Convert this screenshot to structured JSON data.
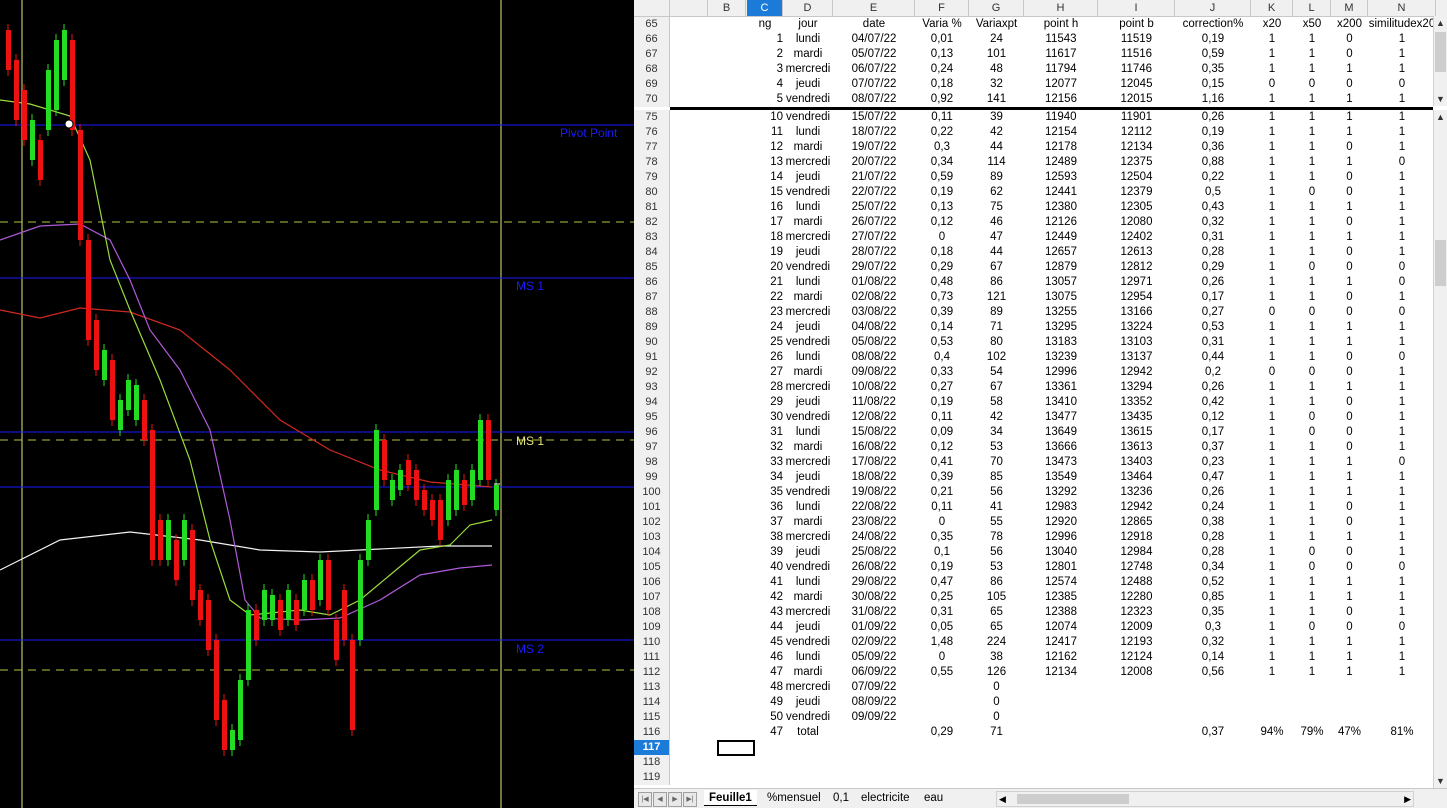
{
  "chart": {
    "labels": {
      "pivot": "Pivot Point",
      "ms1_upper": "MS 1",
      "ms1_lower": "MS 1",
      "ms2": "MS 2"
    },
    "colors": {
      "bull": "#22dd22",
      "bear": "#ee1111",
      "level": "#1a1aff",
      "dash": "#b9c43a",
      "vline": "#e6e67a",
      "ma_green": "#9adb3c",
      "ma_purple": "#b05ad8",
      "ma_red": "#d02a20",
      "ma_white": "#f2f2f2"
    }
  },
  "sheet": {
    "columns": [
      "B",
      "C",
      "D",
      "E",
      "F",
      "G",
      "H",
      "I",
      "J",
      "K",
      "L",
      "M",
      "N"
    ],
    "active_column": "C",
    "header_row": {
      "num": "65",
      "C": "ng",
      "D": "jour",
      "E": "date",
      "F": "Varia %",
      "G": "Variaxpt",
      "H": "point h",
      "I": "point b",
      "J": "correction%",
      "K": "x20",
      "L": "x50",
      "M": "x200",
      "N": "similitudex20"
    },
    "top_rows": [
      [
        "66",
        "1",
        "lundi",
        "04/07/22",
        "0,01",
        "24",
        "11543",
        "11519",
        "0,19",
        "1",
        "1",
        "0",
        "1"
      ],
      [
        "67",
        "2",
        "mardi",
        "05/07/22",
        "0,13",
        "101",
        "11617",
        "11516",
        "0,59",
        "1",
        "1",
        "0",
        "1"
      ],
      [
        "68",
        "3",
        "mercredi",
        "06/07/22",
        "0,24",
        "48",
        "11794",
        "11746",
        "0,35",
        "1",
        "1",
        "1",
        "1"
      ],
      [
        "69",
        "4",
        "jeudi",
        "07/07/22",
        "0,18",
        "32",
        "12077",
        "12045",
        "0,15",
        "0",
        "0",
        "0",
        "0"
      ],
      [
        "70",
        "5",
        "vendredi",
        "08/07/22",
        "0,92",
        "141",
        "12156",
        "12015",
        "1,16",
        "1",
        "1",
        "1",
        "1"
      ]
    ],
    "rows": [
      [
        "75",
        "10",
        "vendredi",
        "15/07/22",
        "0,11",
        "39",
        "11940",
        "11901",
        "0,26",
        "1",
        "1",
        "1",
        "1"
      ],
      [
        "76",
        "11",
        "lundi",
        "18/07/22",
        "0,22",
        "42",
        "12154",
        "12112",
        "0,19",
        "1",
        "1",
        "1",
        "1"
      ],
      [
        "77",
        "12",
        "mardi",
        "19/07/22",
        "0,3",
        "44",
        "12178",
        "12134",
        "0,36",
        "1",
        "1",
        "0",
        "1"
      ],
      [
        "78",
        "13",
        "mercredi",
        "20/07/22",
        "0,34",
        "114",
        "12489",
        "12375",
        "0,88",
        "1",
        "1",
        "1",
        "0"
      ],
      [
        "79",
        "14",
        "jeudi",
        "21/07/22",
        "0,59",
        "89",
        "12593",
        "12504",
        "0,22",
        "1",
        "1",
        "0",
        "1"
      ],
      [
        "80",
        "15",
        "vendredi",
        "22/07/22",
        "0,19",
        "62",
        "12441",
        "12379",
        "0,5",
        "1",
        "0",
        "0",
        "1"
      ],
      [
        "81",
        "16",
        "lundi",
        "25/07/22",
        "0,13",
        "75",
        "12380",
        "12305",
        "0,43",
        "1",
        "1",
        "1",
        "1"
      ],
      [
        "82",
        "17",
        "mardi",
        "26/07/22",
        "0,12",
        "46",
        "12126",
        "12080",
        "0,32",
        "1",
        "1",
        "0",
        "1"
      ],
      [
        "83",
        "18",
        "mercredi",
        "27/07/22",
        "0",
        "47",
        "12449",
        "12402",
        "0,31",
        "1",
        "1",
        "1",
        "1"
      ],
      [
        "84",
        "19",
        "jeudi",
        "28/07/22",
        "0,18",
        "44",
        "12657",
        "12613",
        "0,28",
        "1",
        "1",
        "0",
        "1"
      ],
      [
        "85",
        "20",
        "vendredi",
        "29/07/22",
        "0,29",
        "67",
        "12879",
        "12812",
        "0,29",
        "1",
        "0",
        "0",
        "0"
      ],
      [
        "86",
        "21",
        "lundi",
        "01/08/22",
        "0,48",
        "86",
        "13057",
        "12971",
        "0,26",
        "1",
        "1",
        "1",
        "0"
      ],
      [
        "87",
        "22",
        "mardi",
        "02/08/22",
        "0,73",
        "121",
        "13075",
        "12954",
        "0,17",
        "1",
        "1",
        "0",
        "1"
      ],
      [
        "88",
        "23",
        "mercredi",
        "03/08/22",
        "0,39",
        "89",
        "13255",
        "13166",
        "0,27",
        "0",
        "0",
        "0",
        "0"
      ],
      [
        "89",
        "24",
        "jeudi",
        "04/08/22",
        "0,14",
        "71",
        "13295",
        "13224",
        "0,53",
        "1",
        "1",
        "1",
        "1"
      ],
      [
        "90",
        "25",
        "vendredi",
        "05/08/22",
        "0,53",
        "80",
        "13183",
        "13103",
        "0,31",
        "1",
        "1",
        "1",
        "1"
      ],
      [
        "91",
        "26",
        "lundi",
        "08/08/22",
        "0,4",
        "102",
        "13239",
        "13137",
        "0,44",
        "1",
        "1",
        "0",
        "0"
      ],
      [
        "92",
        "27",
        "mardi",
        "09/08/22",
        "0,33",
        "54",
        "12996",
        "12942",
        "0,2",
        "0",
        "0",
        "0",
        "1"
      ],
      [
        "93",
        "28",
        "mercredi",
        "10/08/22",
        "0,27",
        "67",
        "13361",
        "13294",
        "0,26",
        "1",
        "1",
        "1",
        "1"
      ],
      [
        "94",
        "29",
        "jeudi",
        "11/08/22",
        "0,19",
        "58",
        "13410",
        "13352",
        "0,42",
        "1",
        "1",
        "0",
        "1"
      ],
      [
        "95",
        "30",
        "vendredi",
        "12/08/22",
        "0,11",
        "42",
        "13477",
        "13435",
        "0,12",
        "1",
        "0",
        "0",
        "1"
      ],
      [
        "96",
        "31",
        "lundi",
        "15/08/22",
        "0,09",
        "34",
        "13649",
        "13615",
        "0,17",
        "1",
        "0",
        "0",
        "1"
      ],
      [
        "97",
        "32",
        "mardi",
        "16/08/22",
        "0,12",
        "53",
        "13666",
        "13613",
        "0,37",
        "1",
        "1",
        "0",
        "1"
      ],
      [
        "98",
        "33",
        "mercredi",
        "17/08/22",
        "0,41",
        "70",
        "13473",
        "13403",
        "0,23",
        "1",
        "1",
        "1",
        "0"
      ],
      [
        "99",
        "34",
        "jeudi",
        "18/08/22",
        "0,39",
        "85",
        "13549",
        "13464",
        "0,47",
        "1",
        "1",
        "1",
        "1"
      ],
      [
        "100",
        "35",
        "vendredi",
        "19/08/22",
        "0,21",
        "56",
        "13292",
        "13236",
        "0,26",
        "1",
        "1",
        "1",
        "1"
      ],
      [
        "101",
        "36",
        "lundi",
        "22/08/22",
        "0,11",
        "41",
        "12983",
        "12942",
        "0,24",
        "1",
        "1",
        "0",
        "1"
      ],
      [
        "102",
        "37",
        "mardi",
        "23/08/22",
        "0",
        "55",
        "12920",
        "12865",
        "0,38",
        "1",
        "1",
        "0",
        "1"
      ],
      [
        "103",
        "38",
        "mercredi",
        "24/08/22",
        "0,35",
        "78",
        "12996",
        "12918",
        "0,28",
        "1",
        "1",
        "1",
        "1"
      ],
      [
        "104",
        "39",
        "jeudi",
        "25/08/22",
        "0,1",
        "56",
        "13040",
        "12984",
        "0,28",
        "1",
        "0",
        "0",
        "1"
      ],
      [
        "105",
        "40",
        "vendredi",
        "26/08/22",
        "0,19",
        "53",
        "12801",
        "12748",
        "0,34",
        "1",
        "0",
        "0",
        "0"
      ],
      [
        "106",
        "41",
        "lundi",
        "29/08/22",
        "0,47",
        "86",
        "12574",
        "12488",
        "0,52",
        "1",
        "1",
        "1",
        "1"
      ],
      [
        "107",
        "42",
        "mardi",
        "30/08/22",
        "0,25",
        "105",
        "12385",
        "12280",
        "0,85",
        "1",
        "1",
        "1",
        "1"
      ],
      [
        "108",
        "43",
        "mercredi",
        "31/08/22",
        "0,31",
        "65",
        "12388",
        "12323",
        "0,35",
        "1",
        "1",
        "0",
        "1"
      ],
      [
        "109",
        "44",
        "jeudi",
        "01/09/22",
        "0,05",
        "65",
        "12074",
        "12009",
        "0,3",
        "1",
        "0",
        "0",
        "0"
      ],
      [
        "110",
        "45",
        "vendredi",
        "02/09/22",
        "1,48",
        "224",
        "12417",
        "12193",
        "0,32",
        "1",
        "1",
        "1",
        "1"
      ],
      [
        "111",
        "46",
        "lundi",
        "05/09/22",
        "0",
        "38",
        "12162",
        "12124",
        "0,14",
        "1",
        "1",
        "1",
        "1"
      ],
      [
        "112",
        "47",
        "mardi",
        "06/09/22",
        "0,55",
        "126",
        "12134",
        "12008",
        "0,56",
        "1",
        "1",
        "1",
        "1"
      ],
      [
        "113",
        "48",
        "mercredi",
        "07/09/22",
        "",
        "0",
        "",
        "",
        "",
        "",
        "",
        "",
        ""
      ],
      [
        "114",
        "49",
        "jeudi",
        "08/09/22",
        "",
        "0",
        "",
        "",
        "",
        "",
        "",
        "",
        ""
      ],
      [
        "115",
        "50",
        "vendredi",
        "09/09/22",
        "",
        "0",
        "",
        "",
        "",
        "",
        "",
        "",
        ""
      ],
      [
        "116",
        "47",
        "total",
        "",
        "0,29",
        "71",
        "",
        "",
        "0,37",
        "94%",
        "79%",
        "47%",
        "81%"
      ],
      [
        "117",
        "",
        "",
        "",
        "",
        "",
        "",
        "",
        "",
        "",
        "",
        "",
        ""
      ],
      [
        "118",
        "",
        "",
        "",
        "",
        "",
        "",
        "",
        "",
        "",
        "",
        "",
        ""
      ],
      [
        "119",
        "",
        "",
        "",
        "",
        "",
        "",
        "",
        "",
        "",
        "",
        "",
        ""
      ]
    ],
    "active_row": "117",
    "tabs": [
      "Feuille1",
      "%mensuel",
      "0,1",
      "electricite",
      "eau"
    ],
    "active_tab": "Feuille1"
  }
}
